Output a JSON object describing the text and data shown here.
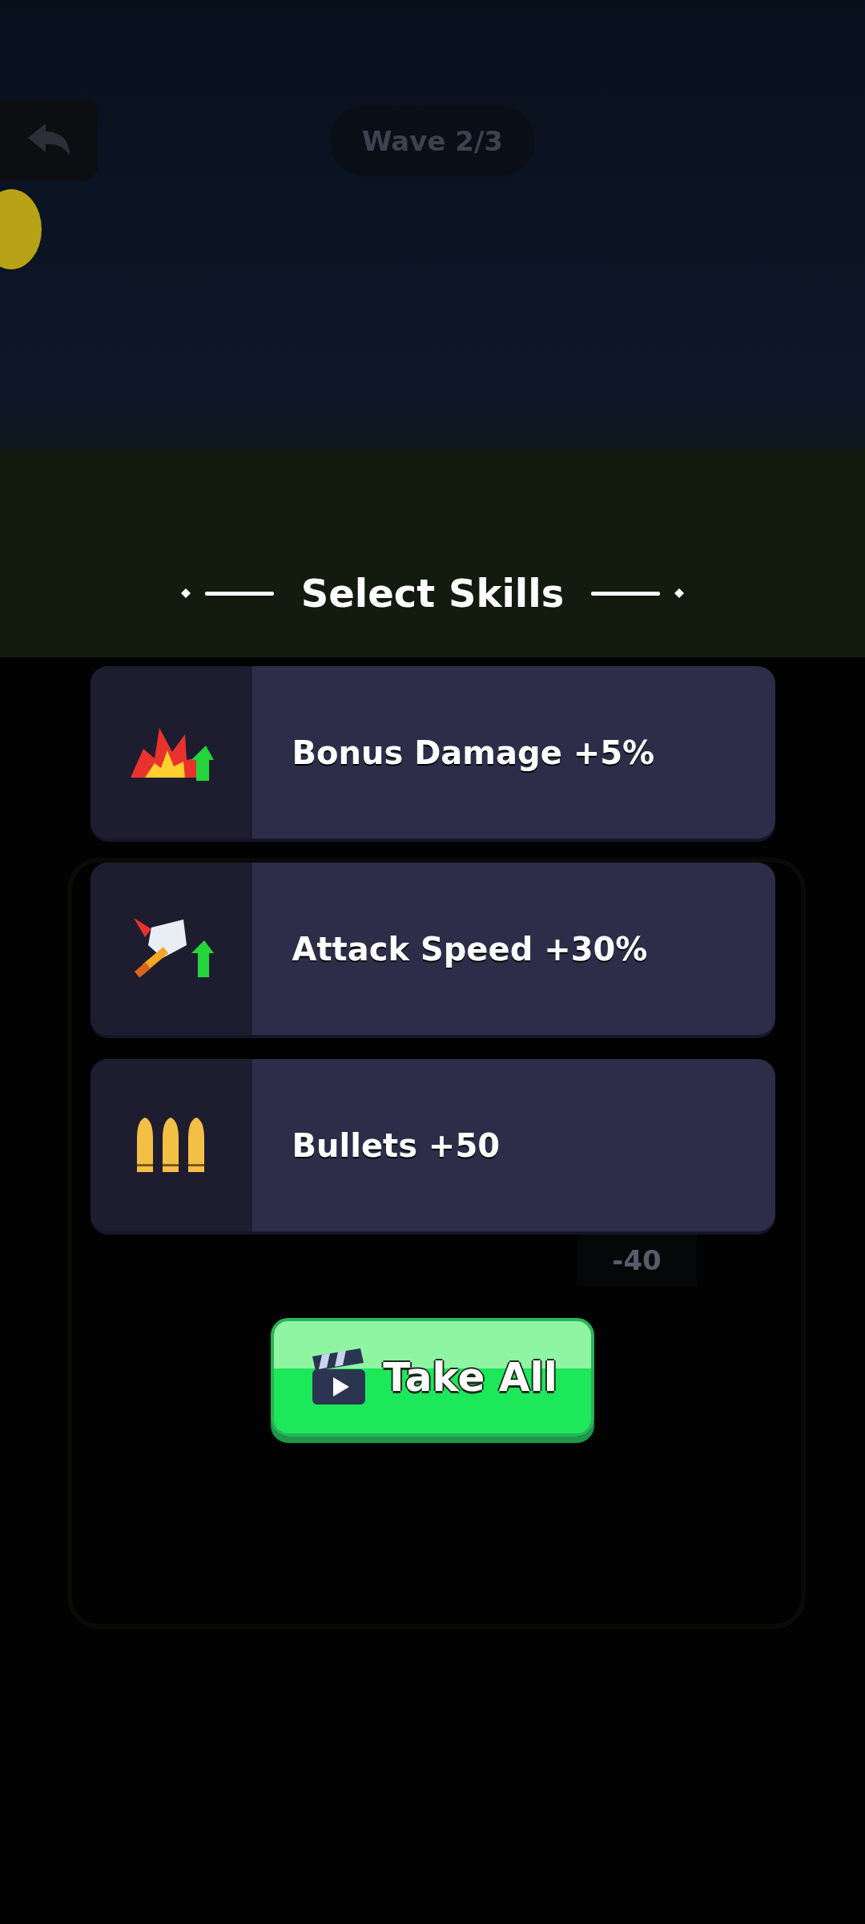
{
  "hud": {
    "wave": "Wave 2/3",
    "damage_tag": "-40"
  },
  "title": "Select Skills",
  "skills": [
    {
      "kind": "damage",
      "label": "Bonus Damage +5%"
    },
    {
      "kind": "speed",
      "label": "Attack Speed +30%"
    },
    {
      "kind": "bullets",
      "label": "Bullets +50"
    }
  ],
  "take_all_button": {
    "label": "Take All"
  }
}
